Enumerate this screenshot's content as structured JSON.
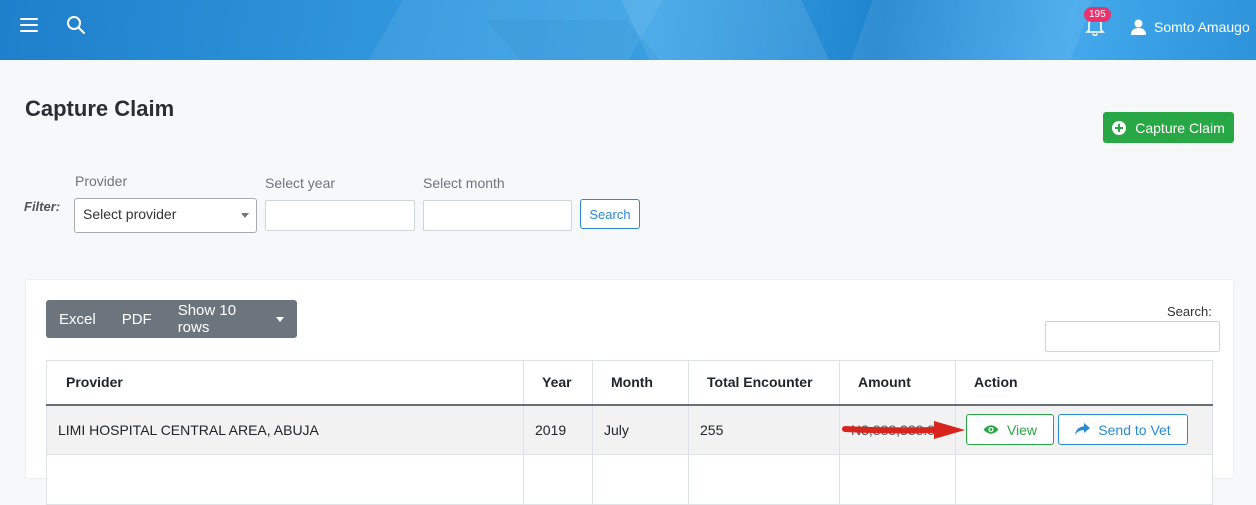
{
  "topbar": {
    "notification_count": "195",
    "user_name": "Somto Amaugo"
  },
  "page": {
    "title": "Capture Claim",
    "capture_button_label": "Capture Claim"
  },
  "filter": {
    "label": "Filter:",
    "provider_label": "Provider",
    "provider_value": "Select provider",
    "year_label": "Select year",
    "year_value": "",
    "month_label": "Select month",
    "month_value": "",
    "search_button_label": "Search"
  },
  "table_toolbar": {
    "excel_label": "Excel",
    "pdf_label": "PDF",
    "show_rows_label": "Show 10 rows",
    "search_label": "Search:",
    "search_value": ""
  },
  "table": {
    "columns": [
      "Provider",
      "Year",
      "Month",
      "Total Encounter",
      "Amount",
      "Action"
    ],
    "rows": [
      {
        "provider": "LIMI HOSPITAL CENTRAL AREA, ABUJA",
        "year": "2019",
        "month": "July",
        "total_encounter": "255",
        "amount": "N3,888,388.88",
        "view_label": "View",
        "send_label": "Send to Vet"
      }
    ]
  },
  "colors": {
    "accent_green": "#28a745",
    "accent_blue": "#2a8bd4",
    "badge_pink": "#e8336d",
    "annotation_arrow": "#d9231d"
  },
  "icons": [
    "menu-icon",
    "search-icon",
    "bell-icon",
    "user-icon",
    "plus-circle-icon",
    "eye-icon",
    "share-icon",
    "caret-down-icon"
  ]
}
